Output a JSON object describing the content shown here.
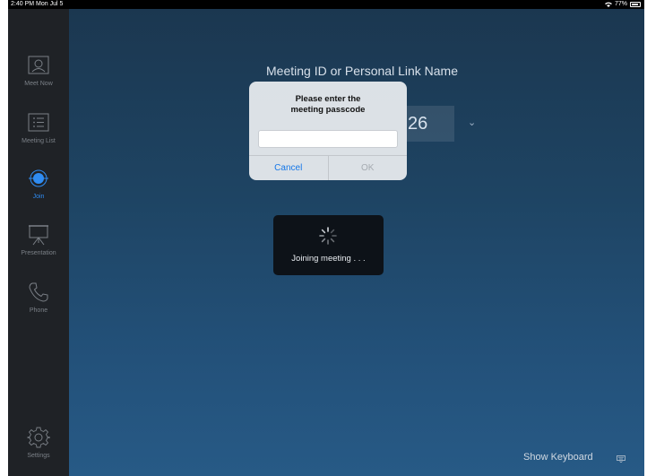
{
  "status_bar": {
    "time": "2:40 PM  Mon Jul 5",
    "battery": "77%"
  },
  "sidebar": {
    "items": [
      {
        "label": "Meet Now",
        "icon": "meet-now-icon",
        "active": false
      },
      {
        "label": "Meeting List",
        "icon": "meeting-list-icon",
        "active": false
      },
      {
        "label": "Join",
        "icon": "join-icon",
        "active": true
      },
      {
        "label": "Presentation",
        "icon": "presentation-icon",
        "active": false
      },
      {
        "label": "Phone",
        "icon": "phone-icon",
        "active": false
      },
      {
        "label": "Settings",
        "icon": "settings-icon",
        "active": false
      }
    ]
  },
  "main": {
    "title": "Meeting ID or Personal Link Name",
    "meeting_id_visible": "26",
    "show_keyboard": "Show Keyboard"
  },
  "dialog": {
    "title_line1": "Please enter the",
    "title_line2": "meeting passcode",
    "passcode_value": "",
    "cancel": "Cancel",
    "ok": "OK"
  },
  "hud": {
    "label": "Joining meeting . . ."
  },
  "colors": {
    "accent": "#2f8cf2",
    "sidebar": "#1f2226",
    "background": "#1e4463"
  }
}
